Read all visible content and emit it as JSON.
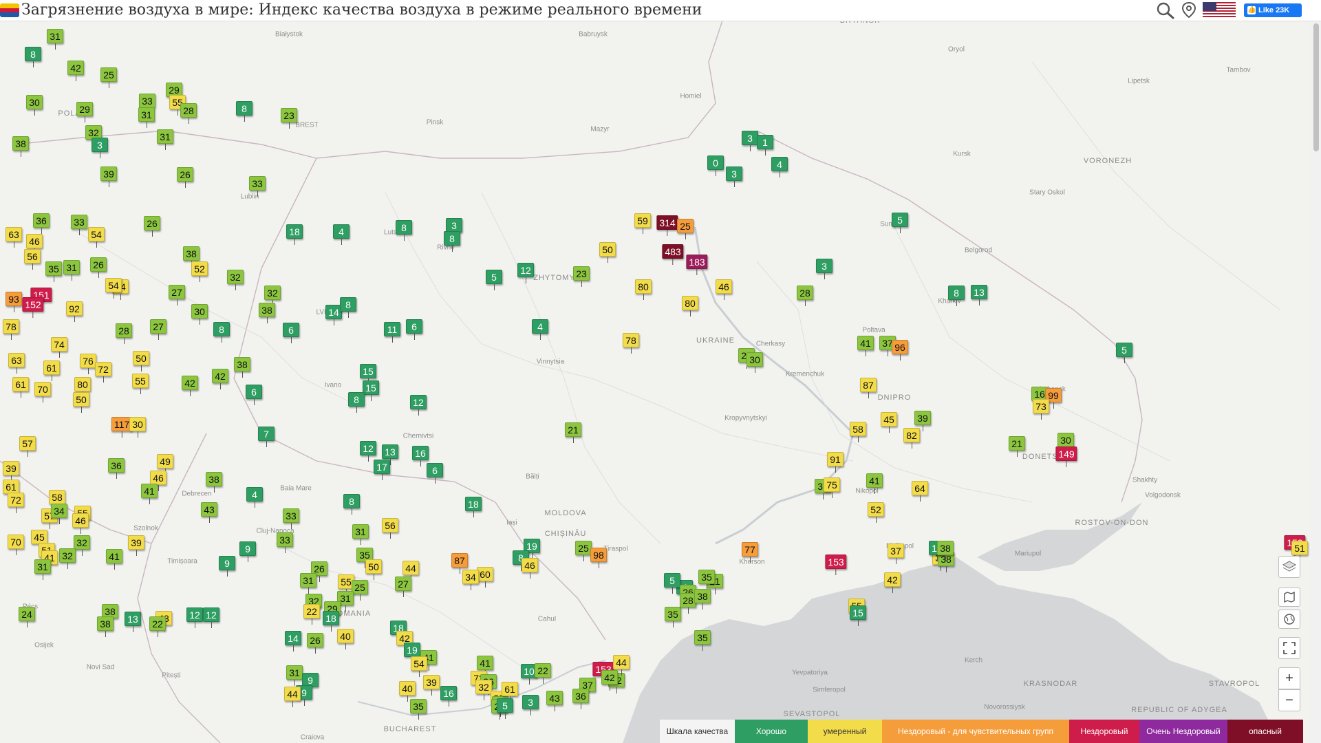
{
  "header": {
    "title": "Загрязнение воздуха в мире: Индекс качества воздуха в режиме реального времени",
    "like_label": "Like 23K",
    "flag_colors": [
      "#f4c400",
      "#d0193e",
      "#1f5aa8"
    ]
  },
  "legend": {
    "scale_label": "Шкала качества",
    "levels": [
      {
        "label": "Хорошо",
        "color": "#2f9e63"
      },
      {
        "label": "умеренный",
        "color": "#f3dc4a"
      },
      {
        "label": "Нездоровый - для чувствительных групп",
        "color": "#f59c3b"
      },
      {
        "label": "Нездоровый",
        "color": "#cf1d4b"
      },
      {
        "label": "Очень Нездоровый",
        "color": "#8e2a9e"
      },
      {
        "label": "опасный",
        "color": "#7e0f26"
      }
    ]
  },
  "geo_labels": [
    "Białystok",
    "BRYANSK",
    "Babruysk",
    "Oryol",
    "Tambov",
    "Lipetsk",
    "Homiel",
    "BREST",
    "Pinsk",
    "Mazyr",
    "Kursk",
    "VORONEZH",
    "Lublin",
    "Stary Oskol",
    "Sumy",
    "Lutsk",
    "Rivne",
    "ZHYTOMYR",
    "Belgorod",
    "LVIV",
    "Kharkiv",
    "UKRAINE",
    "Poltava",
    "Vinnytsia",
    "Cherkasy",
    "Kremenchuk",
    "Ivano",
    "Kropyvnytskyi",
    "Luhansk",
    "Chernivtsi",
    "DNIPRO",
    "DONETSK",
    "Bălți",
    "Debrecen",
    "Baia Mare",
    "Shakhty",
    "Nikopol",
    "Szolnok",
    "Volgodonsk",
    "MOLDOVA",
    "Iași",
    "CHIȘINĂU",
    "Mariupol",
    "ROSTOV-ON-DON",
    "Tiraspol",
    "Melitopol",
    "Cluj-Napoca",
    "Kherson",
    "Timișoara",
    "ROMANIA",
    "Pécs",
    "Osijek",
    "Novi Sad",
    "Pitești",
    "Cahul",
    "Yevpatoriya",
    "Kerch",
    "KRASNODAR",
    "STAVROPOL",
    "Simferopol",
    "Novorossiysk",
    "SEVASTOPOL",
    "REPUBLIC OF ADYGEA",
    "BUCHAREST",
    "Craiova",
    "POLAND"
  ],
  "aqi_stations": [
    {
      "v": "31",
      "l": "lgr"
    },
    {
      "v": "8",
      "l": "good"
    },
    {
      "v": "42",
      "l": "lgr"
    },
    {
      "v": "25",
      "l": "lgr"
    },
    {
      "v": "30",
      "l": "lgr"
    },
    {
      "v": "29",
      "l": "lgr"
    },
    {
      "v": "33",
      "l": "lgr"
    },
    {
      "v": "29",
      "l": "lgr"
    },
    {
      "v": "55",
      "l": "mod"
    },
    {
      "v": "31",
      "l": "lgr"
    },
    {
      "v": "28",
      "l": "lgr"
    },
    {
      "v": "8",
      "l": "good"
    },
    {
      "v": "23",
      "l": "lgr"
    },
    {
      "v": "32",
      "l": "lgr"
    },
    {
      "v": "38",
      "l": "lgr"
    },
    {
      "v": "31",
      "l": "lgr"
    },
    {
      "v": "3",
      "l": "good"
    },
    {
      "v": "3",
      "l": "good"
    },
    {
      "v": "1",
      "l": "good"
    },
    {
      "v": "0",
      "l": "good"
    },
    {
      "v": "3",
      "l": "good"
    },
    {
      "v": "4",
      "l": "good"
    },
    {
      "v": "39",
      "l": "lgr"
    },
    {
      "v": "26",
      "l": "lgr"
    },
    {
      "v": "33",
      "l": "lgr"
    },
    {
      "v": "36",
      "l": "lgr"
    },
    {
      "v": "33",
      "l": "lgr"
    },
    {
      "v": "26",
      "l": "lgr"
    },
    {
      "v": "63",
      "l": "mod"
    },
    {
      "v": "46",
      "l": "mod"
    },
    {
      "v": "54",
      "l": "mod"
    },
    {
      "v": "56",
      "l": "mod"
    },
    {
      "v": "18",
      "l": "good"
    },
    {
      "v": "4",
      "l": "good"
    },
    {
      "v": "8",
      "l": "good"
    },
    {
      "v": "3",
      "l": "good"
    },
    {
      "v": "8",
      "l": "good"
    },
    {
      "v": "59",
      "l": "mod"
    },
    {
      "v": "314",
      "l": "haz"
    },
    {
      "v": "25",
      "l": "usg"
    },
    {
      "v": "5",
      "l": "good"
    },
    {
      "v": "38",
      "l": "lgr"
    },
    {
      "v": "52",
      "l": "mod"
    },
    {
      "v": "32",
      "l": "lgr"
    },
    {
      "v": "50",
      "l": "mod"
    },
    {
      "v": "483",
      "l": "haz"
    },
    {
      "v": "183",
      "l": "vun"
    },
    {
      "v": "35",
      "l": "lgr"
    },
    {
      "v": "31",
      "l": "lgr"
    },
    {
      "v": "26",
      "l": "lgr"
    },
    {
      "v": "54",
      "l": "mod"
    },
    {
      "v": "12",
      "l": "good"
    },
    {
      "v": "23",
      "l": "lgr"
    },
    {
      "v": "5",
      "l": "good"
    },
    {
      "v": "3",
      "l": "good"
    },
    {
      "v": "80",
      "l": "mod"
    },
    {
      "v": "46",
      "l": "mod"
    },
    {
      "v": "28",
      "l": "lgr"
    },
    {
      "v": "13",
      "l": "good"
    },
    {
      "v": "8",
      "l": "good"
    },
    {
      "v": "93",
      "l": "usg"
    },
    {
      "v": "151",
      "l": "unh"
    },
    {
      "v": "152",
      "l": "unh"
    },
    {
      "v": "92",
      "l": "mod"
    },
    {
      "v": "27",
      "l": "lgr"
    },
    {
      "v": "32",
      "l": "lgr"
    },
    {
      "v": "14",
      "l": "good"
    },
    {
      "v": "8",
      "l": "good"
    },
    {
      "v": "80",
      "l": "mod"
    },
    {
      "v": "54",
      "l": "mod"
    },
    {
      "v": "30",
      "l": "lgr"
    },
    {
      "v": "38",
      "l": "lgr"
    },
    {
      "v": "78",
      "l": "mod"
    },
    {
      "v": "28",
      "l": "lgr"
    },
    {
      "v": "27",
      "l": "lgr"
    },
    {
      "v": "8",
      "l": "good"
    },
    {
      "v": "6",
      "l": "good"
    },
    {
      "v": "11",
      "l": "good"
    },
    {
      "v": "6",
      "l": "good"
    },
    {
      "v": "4",
      "l": "good"
    },
    {
      "v": "78",
      "l": "mod"
    },
    {
      "v": "27",
      "l": "lgr"
    },
    {
      "v": "30",
      "l": "lgr"
    },
    {
      "v": "41",
      "l": "lgr"
    },
    {
      "v": "37",
      "l": "lgr"
    },
    {
      "v": "5",
      "l": "good"
    },
    {
      "v": "74",
      "l": "mod"
    },
    {
      "v": "63",
      "l": "mod"
    },
    {
      "v": "61",
      "l": "mod"
    },
    {
      "v": "76",
      "l": "mod"
    },
    {
      "v": "72",
      "l": "mod"
    },
    {
      "v": "50",
      "l": "mod"
    },
    {
      "v": "55",
      "l": "mod"
    },
    {
      "v": "42",
      "l": "lgr"
    },
    {
      "v": "42",
      "l": "lgr"
    },
    {
      "v": "38",
      "l": "lgr"
    },
    {
      "v": "15",
      "l": "good"
    },
    {
      "v": "15",
      "l": "good"
    },
    {
      "v": "96",
      "l": "usg"
    },
    {
      "v": "87",
      "l": "mod"
    },
    {
      "v": "61",
      "l": "mod"
    },
    {
      "v": "80",
      "l": "mod"
    },
    {
      "v": "70",
      "l": "mod"
    },
    {
      "v": "50",
      "l": "mod"
    },
    {
      "v": "6",
      "l": "good"
    },
    {
      "v": "8",
      "l": "good"
    },
    {
      "v": "12",
      "l": "good"
    },
    {
      "v": "16",
      "l": "lgr"
    },
    {
      "v": "99",
      "l": "usg"
    },
    {
      "v": "73",
      "l": "mod"
    },
    {
      "v": "117",
      "l": "usg"
    },
    {
      "v": "30",
      "l": "mod"
    },
    {
      "v": "7",
      "l": "good"
    },
    {
      "v": "21",
      "l": "lgr"
    },
    {
      "v": "58",
      "l": "mod"
    },
    {
      "v": "45",
      "l": "mod"
    },
    {
      "v": "39",
      "l": "lgr"
    },
    {
      "v": "82",
      "l": "mod"
    },
    {
      "v": "21",
      "l": "lgr"
    },
    {
      "v": "30",
      "l": "lgr"
    },
    {
      "v": "149",
      "l": "unh"
    },
    {
      "v": "57",
      "l": "mod"
    },
    {
      "v": "39",
      "l": "mod"
    },
    {
      "v": "12",
      "l": "good"
    },
    {
      "v": "13",
      "l": "good"
    },
    {
      "v": "17",
      "l": "good"
    },
    {
      "v": "16",
      "l": "good"
    },
    {
      "v": "6",
      "l": "good"
    },
    {
      "v": "36",
      "l": "lgr"
    },
    {
      "v": "49",
      "l": "mod"
    },
    {
      "v": "46",
      "l": "mod"
    },
    {
      "v": "41",
      "l": "lgr"
    },
    {
      "v": "38",
      "l": "lgr"
    },
    {
      "v": "4",
      "l": "good"
    },
    {
      "v": "61",
      "l": "mod"
    },
    {
      "v": "72",
      "l": "mod"
    },
    {
      "v": "58",
      "l": "mod"
    },
    {
      "v": "37",
      "l": "lgr"
    },
    {
      "v": "75",
      "l": "mod"
    },
    {
      "v": "91",
      "l": "mod"
    },
    {
      "v": "41",
      "l": "lgr"
    },
    {
      "v": "64",
      "l": "mod"
    },
    {
      "v": "57",
      "l": "mod"
    },
    {
      "v": "43",
      "l": "lgr"
    },
    {
      "v": "55",
      "l": "mod"
    },
    {
      "v": "33",
      "l": "lgr"
    },
    {
      "v": "8",
      "l": "good"
    },
    {
      "v": "34",
      "l": "lgr"
    },
    {
      "v": "46",
      "l": "mod"
    },
    {
      "v": "32",
      "l": "lgr"
    },
    {
      "v": "18",
      "l": "good"
    },
    {
      "v": "52",
      "l": "mod"
    },
    {
      "v": "45",
      "l": "mod"
    },
    {
      "v": "51",
      "l": "mod"
    },
    {
      "v": "39",
      "l": "mod"
    },
    {
      "v": "41",
      "l": "lgr"
    },
    {
      "v": "9",
      "l": "good"
    },
    {
      "v": "9",
      "l": "good"
    },
    {
      "v": "33",
      "l": "lgr"
    },
    {
      "v": "31",
      "l": "lgr"
    },
    {
      "v": "56",
      "l": "mod"
    },
    {
      "v": "35",
      "l": "lgr"
    },
    {
      "v": "19",
      "l": "good"
    },
    {
      "v": "8",
      "l": "good"
    },
    {
      "v": "25",
      "l": "lgr"
    },
    {
      "v": "98",
      "l": "usg"
    },
    {
      "v": "77",
      "l": "usg"
    },
    {
      "v": "153",
      "l": "unh"
    },
    {
      "v": "153",
      "l": "unh"
    },
    {
      "v": "51",
      "l": "mod"
    },
    {
      "v": "39",
      "l": "mod"
    },
    {
      "v": "38",
      "l": "lgr"
    },
    {
      "v": "12",
      "l": "good"
    },
    {
      "v": "38",
      "l": "lgr"
    },
    {
      "v": "32",
      "l": "lgr"
    },
    {
      "v": "41",
      "l": "mod"
    },
    {
      "v": "31",
      "l": "lgr"
    },
    {
      "v": "70",
      "l": "mod"
    },
    {
      "v": "87",
      "l": "usg"
    },
    {
      "v": "46",
      "l": "mod"
    },
    {
      "v": "60",
      "l": "mod"
    },
    {
      "v": "4",
      "l": "good"
    },
    {
      "v": "5",
      "l": "good"
    },
    {
      "v": "21",
      "l": "lgr"
    },
    {
      "v": "26",
      "l": "lgr"
    },
    {
      "v": "35",
      "l": "lgr"
    },
    {
      "v": "42",
      "l": "mod"
    },
    {
      "v": "37",
      "l": "mod"
    },
    {
      "v": "55",
      "l": "mod"
    },
    {
      "v": "15",
      "l": "good"
    },
    {
      "v": "26",
      "l": "lgr"
    },
    {
      "v": "50",
      "l": "mod"
    },
    {
      "v": "44",
      "l": "mod"
    },
    {
      "v": "31",
      "l": "lgr"
    },
    {
      "v": "55",
      "l": "mod"
    },
    {
      "v": "25",
      "l": "lgr"
    },
    {
      "v": "31",
      "l": "lgr"
    },
    {
      "v": "32",
      "l": "lgr"
    },
    {
      "v": "34",
      "l": "mod"
    },
    {
      "v": "27",
      "l": "lgr"
    },
    {
      "v": "35",
      "l": "lgr"
    },
    {
      "v": "28",
      "l": "lgr"
    },
    {
      "v": "38",
      "l": "lgr"
    },
    {
      "v": "29",
      "l": "lgr"
    },
    {
      "v": "18",
      "l": "good"
    },
    {
      "v": "22",
      "l": "mod"
    },
    {
      "v": "24",
      "l": "lgr"
    },
    {
      "v": "38",
      "l": "lgr"
    },
    {
      "v": "38",
      "l": "lgr"
    },
    {
      "v": "13",
      "l": "good"
    },
    {
      "v": "43",
      "l": "mod"
    },
    {
      "v": "12",
      "l": "good"
    },
    {
      "v": "12",
      "l": "good"
    },
    {
      "v": "22",
      "l": "lgr"
    },
    {
      "v": "35",
      "l": "lgr"
    },
    {
      "v": "18",
      "l": "good"
    },
    {
      "v": "42",
      "l": "mod"
    },
    {
      "v": "40",
      "l": "mod"
    },
    {
      "v": "14",
      "l": "good"
    },
    {
      "v": "26",
      "l": "lgr"
    },
    {
      "v": "19",
      "l": "good"
    },
    {
      "v": "41",
      "l": "lgr"
    },
    {
      "v": "54",
      "l": "mod"
    },
    {
      "v": "31",
      "l": "lgr"
    },
    {
      "v": "9",
      "l": "good"
    },
    {
      "v": "9",
      "l": "good"
    },
    {
      "v": "44",
      "l": "mod"
    },
    {
      "v": "41",
      "l": "lgr"
    },
    {
      "v": "73",
      "l": "mod"
    },
    {
      "v": "10",
      "l": "good"
    },
    {
      "v": "36",
      "l": "lgr"
    },
    {
      "v": "39",
      "l": "mod"
    },
    {
      "v": "40",
      "l": "mod"
    },
    {
      "v": "16",
      "l": "good"
    },
    {
      "v": "3",
      "l": "good"
    },
    {
      "v": "32",
      "l": "mod"
    },
    {
      "v": "38",
      "l": "mod"
    },
    {
      "v": "35",
      "l": "lgr"
    },
    {
      "v": "37",
      "l": "lgr"
    },
    {
      "v": "61",
      "l": "mod"
    },
    {
      "v": "25",
      "l": "lgr"
    },
    {
      "v": "5",
      "l": "good"
    },
    {
      "v": "22",
      "l": "lgr"
    },
    {
      "v": "43",
      "l": "lgr"
    },
    {
      "v": "37",
      "l": "lgr"
    },
    {
      "v": "36",
      "l": "lgr"
    },
    {
      "v": "153",
      "l": "unh"
    },
    {
      "v": "22",
      "l": "lgr"
    },
    {
      "v": "44",
      "l": "mod"
    },
    {
      "v": "42",
      "l": "lgr"
    }
  ],
  "controls": {
    "zoom_in": "+",
    "zoom_out": "−"
  }
}
